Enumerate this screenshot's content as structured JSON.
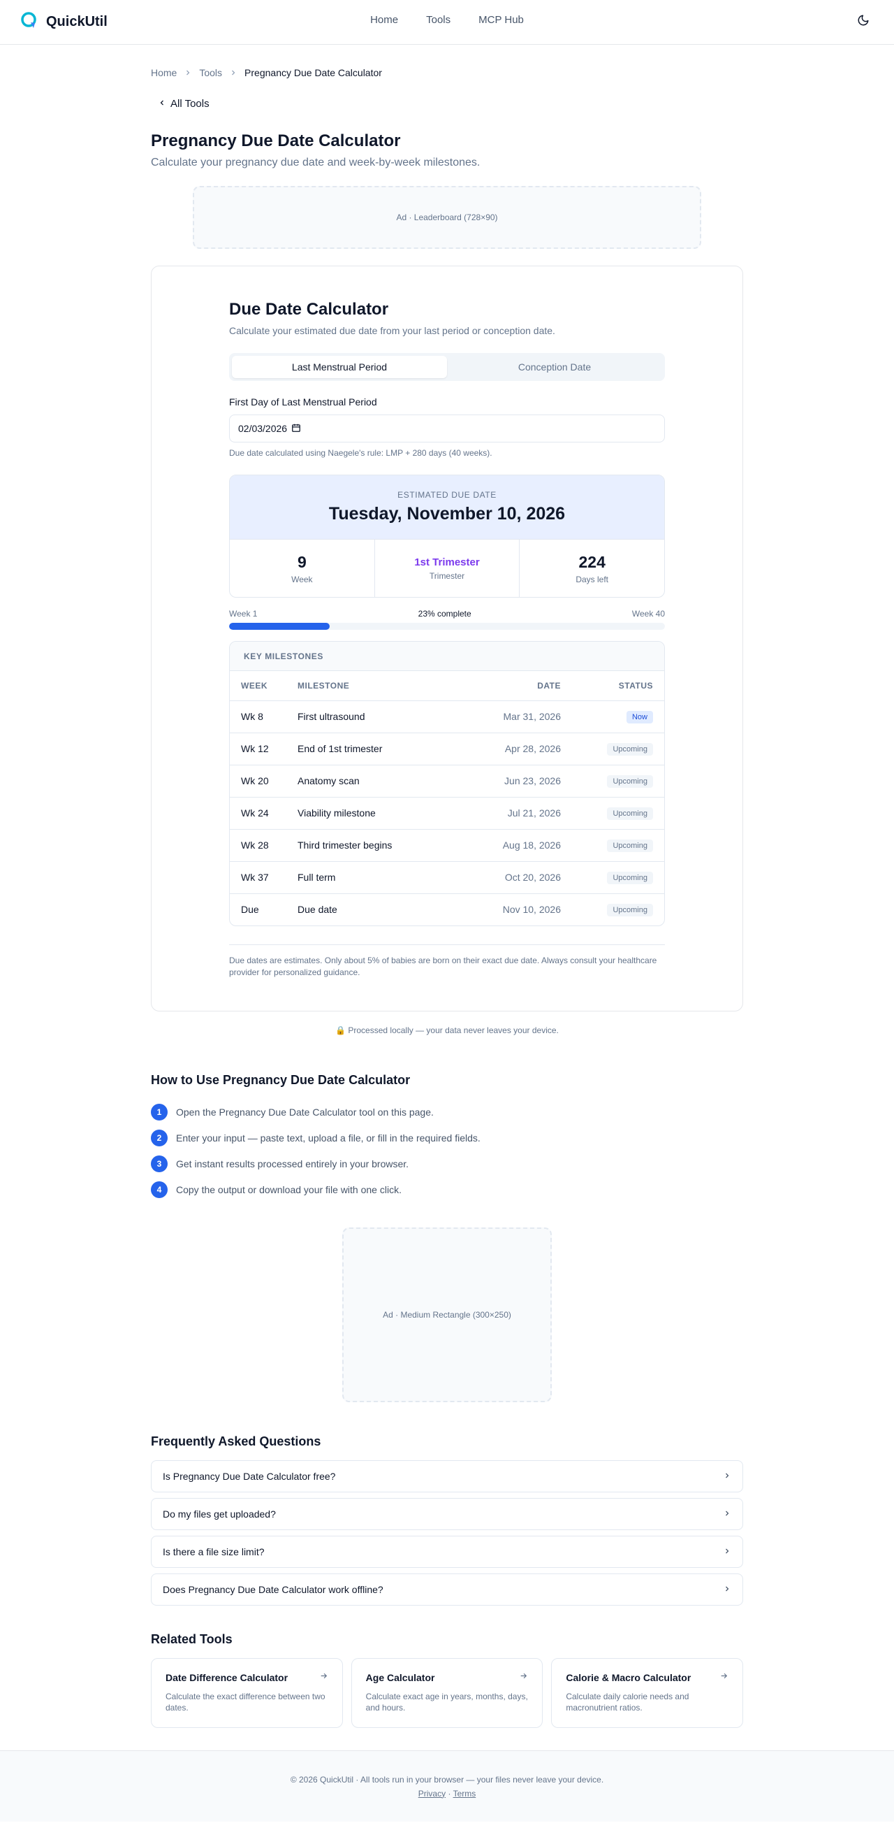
{
  "header": {
    "brand": "QuickUtil",
    "nav": [
      "Home",
      "Tools",
      "MCP Hub"
    ]
  },
  "breadcrumb": {
    "home": "Home",
    "tools": "Tools",
    "current": "Pregnancy Due Date Calculator"
  },
  "back_link": "All Tools",
  "page": {
    "title": "Pregnancy Due Date Calculator",
    "subtitle": "Calculate your pregnancy due date and week-by-week milestones."
  },
  "ads": {
    "leaderboard": "Ad · Leaderboard (728×90)",
    "rectangle": "Ad · Medium Rectangle (300×250)"
  },
  "calculator": {
    "title": "Due Date Calculator",
    "subtitle": "Calculate your estimated due date from your last period or conception date.",
    "tabs": [
      "Last Menstrual Period",
      "Conception Date"
    ],
    "active_tab": 0,
    "field_label": "First Day of Last Menstrual Period",
    "date_value": "02/03/2026",
    "hint": "Due date calculated using Naegele's rule: LMP + 280 days (40 weeks).",
    "result": {
      "label": "ESTIMATED DUE DATE",
      "date": "Tuesday, November 10, 2026",
      "week_value": "9",
      "week_label": "Week",
      "trimester_value": "1st Trimester",
      "trimester_label": "Trimester",
      "days_value": "224",
      "days_label": "Days left"
    },
    "progress": {
      "start_label": "Week 1",
      "percent_label": "23% complete",
      "end_label": "Week 40",
      "fraction": 0.23
    },
    "milestones": {
      "heading": "KEY MILESTONES",
      "columns": {
        "week": "WEEK",
        "milestone": "MILESTONE",
        "date": "DATE",
        "status": "STATUS"
      },
      "rows": [
        {
          "week": "Wk 8",
          "milestone": "First ultrasound",
          "date": "Mar 31, 2026",
          "status": "Now"
        },
        {
          "week": "Wk 12",
          "milestone": "End of 1st trimester",
          "date": "Apr 28, 2026",
          "status": "Upcoming"
        },
        {
          "week": "Wk 20",
          "milestone": "Anatomy scan",
          "date": "Jun 23, 2026",
          "status": "Upcoming"
        },
        {
          "week": "Wk 24",
          "milestone": "Viability milestone",
          "date": "Jul 21, 2026",
          "status": "Upcoming"
        },
        {
          "week": "Wk 28",
          "milestone": "Third trimester begins",
          "date": "Aug 18, 2026",
          "status": "Upcoming"
        },
        {
          "week": "Wk 37",
          "milestone": "Full term",
          "date": "Oct 20, 2026",
          "status": "Upcoming"
        },
        {
          "week": "Due",
          "milestone": "Due date",
          "date": "Nov 10, 2026",
          "status": "Upcoming"
        }
      ]
    },
    "disclaimer": "Due dates are estimates. Only about 5% of babies are born on their exact due date. Always consult your healthcare provider for personalized guidance."
  },
  "local_note": "🔒 Processed locally — your data never leaves your device.",
  "howto": {
    "title": "How to Use Pregnancy Due Date Calculator",
    "steps": [
      "Open the Pregnancy Due Date Calculator tool on this page.",
      "Enter your input — paste text, upload a file, or fill in the required fields.",
      "Get instant results processed entirely in your browser.",
      "Copy the output or download your file with one click."
    ]
  },
  "faq": {
    "title": "Frequently Asked Questions",
    "items": [
      "Is Pregnancy Due Date Calculator free?",
      "Do my files get uploaded?",
      "Is there a file size limit?",
      "Does Pregnancy Due Date Calculator work offline?"
    ]
  },
  "related": {
    "title": "Related Tools",
    "items": [
      {
        "name": "Date Difference Calculator",
        "desc": "Calculate the exact difference between two dates."
      },
      {
        "name": "Age Calculator",
        "desc": "Calculate exact age in years, months, days, and hours."
      },
      {
        "name": "Calorie & Macro Calculator",
        "desc": "Calculate daily calorie needs and macronutrient ratios."
      }
    ]
  },
  "footer": {
    "text": "© 2026 QuickUtil · All tools run in your browser — your files never leave your device.",
    "privacy": "Privacy",
    "separator": "·",
    "terms": "Terms"
  },
  "colors": {
    "accent": "#2563eb",
    "brand_icon": "#06b6d4",
    "trimester": "#7c3aed",
    "result_bg": "#e8efff"
  }
}
